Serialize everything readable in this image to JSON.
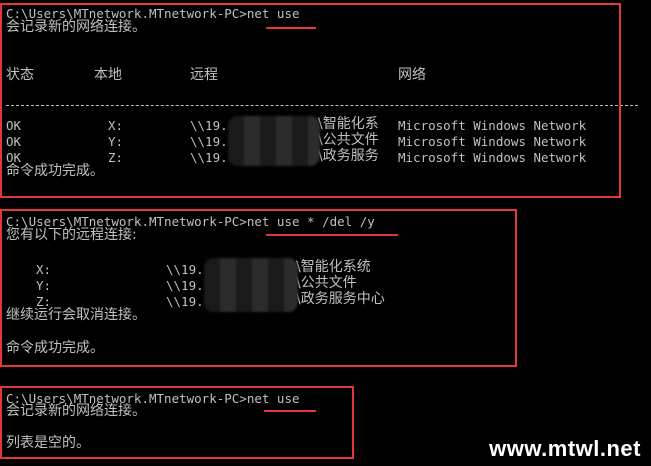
{
  "block1": {
    "cmd": "C:\\Users\\MTnetwork.MTnetwork-PC>net use",
    "msg": "会记录新的网络连接。",
    "headers": {
      "status": "状态",
      "local": "本地",
      "remote": "远程",
      "network": "网络"
    },
    "rows": [
      {
        "status": "OK",
        "local": "X:",
        "remote": "\\\\19.",
        "share": "\\智能化系",
        "network": "Microsoft Windows Network"
      },
      {
        "status": "OK",
        "local": "Y:",
        "remote": "\\\\19.",
        "share": "\\公共文件",
        "network": "Microsoft Windows Network"
      },
      {
        "status": "OK",
        "local": "Z:",
        "remote": "\\\\19.",
        "share": "\\政务服务",
        "network": "Microsoft Windows Network"
      }
    ],
    "done": "命令成功完成。"
  },
  "block2": {
    "cmd": "C:\\Users\\MTnetwork.MTnetwork-PC>net use * /del /y",
    "msg": "您有以下的远程连接:",
    "rows": [
      {
        "local": "X:",
        "remote": "\\\\19.",
        "share": "\\智能化系统"
      },
      {
        "local": "Y:",
        "remote": "\\\\19.",
        "share": "\\公共文件"
      },
      {
        "local": "Z:",
        "remote": "\\\\19.",
        "share": "\\政务服务中心"
      }
    ],
    "warn": "继续运行会取消连接。",
    "done": "命令成功完成。"
  },
  "block3": {
    "cmd": "C:\\Users\\MTnetwork.MTnetwork-PC>net use",
    "msg": "会记录新的网络连接。",
    "empty": "列表是空的。"
  },
  "watermark": "www.mtwl.net",
  "colors": {
    "highlight": "#e0383c",
    "text": "#c0c0c0",
    "background": "#000000"
  }
}
